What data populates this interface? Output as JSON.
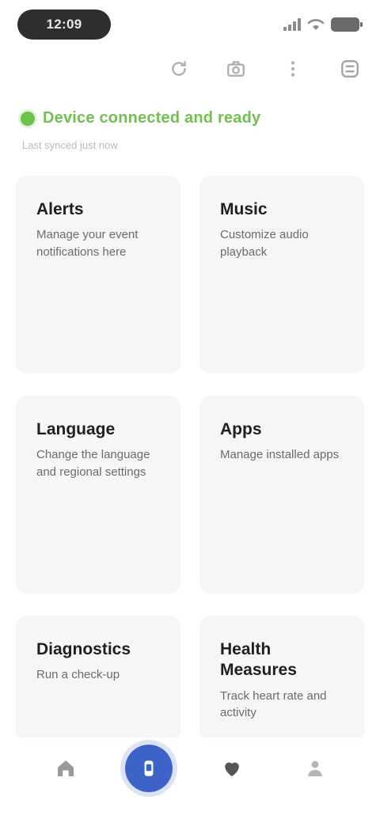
{
  "status_bar": {
    "time": "12:09",
    "icons": [
      "signal-icon",
      "wifi-icon",
      "battery-icon"
    ]
  },
  "header": {
    "icons": [
      "refresh-icon",
      "camera-icon",
      "more-icon",
      "settings-icon"
    ]
  },
  "device_status": {
    "text": "Device connected and ready",
    "sub": "Last synced just now",
    "color": "#72c150"
  },
  "cards": [
    {
      "title": "Alerts",
      "desc": "Manage your event notifications here"
    },
    {
      "title": "Music",
      "desc": "Customize audio playback"
    },
    {
      "title": "Language",
      "desc": "Change the language and regional settings"
    },
    {
      "title": "Apps",
      "desc": "Manage installed apps"
    },
    {
      "title": "Diagnostics",
      "desc": "Run a check-up"
    },
    {
      "title": "Health Measures",
      "desc": "Track heart rate and activity"
    }
  ],
  "bottom_nav": {
    "items": [
      "home-icon",
      "device-icon",
      "health-icon",
      "profile-icon"
    ],
    "active_index": 1,
    "accent": "#3d63c9"
  }
}
